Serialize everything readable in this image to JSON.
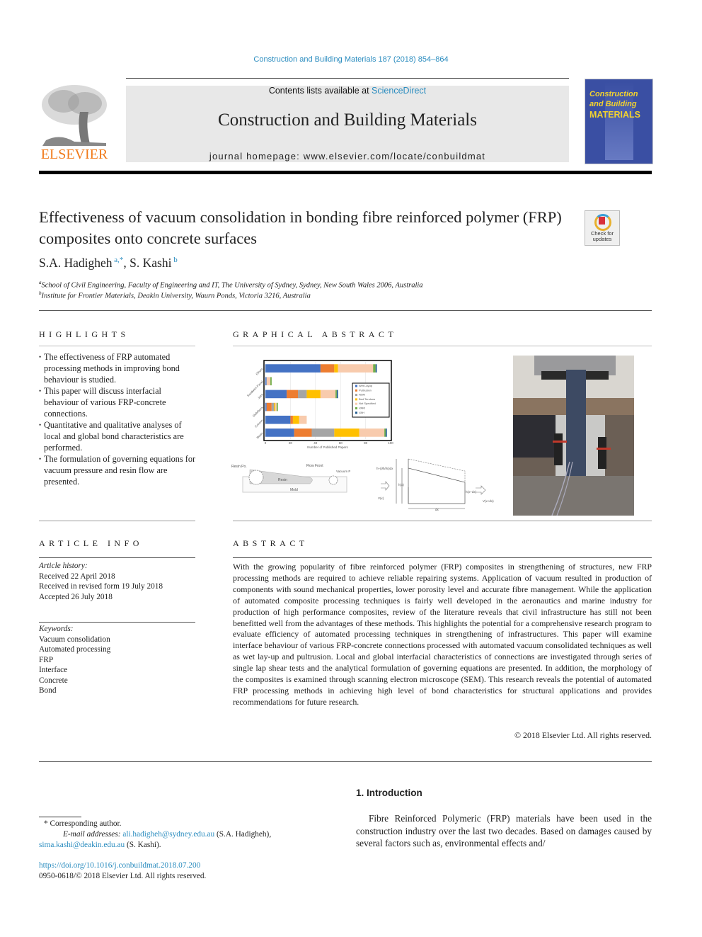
{
  "header": {
    "citation": "Construction and Building Materials 187 (2018) 854–864",
    "contents_prefix": "Contents lists available at ",
    "contents_link": "ScienceDirect",
    "journal_title": "Construction and Building Materials",
    "homepage": "journal homepage: www.elsevier.com/locate/conbuildmat",
    "publisher_logo": "ELSEVIER",
    "cover": {
      "line1": "Construction",
      "line2": "and Building",
      "line3": "MATERIALS"
    },
    "colors": {
      "link": "#2a8cbf",
      "elsevier_orange": "#f07a1a",
      "cover_blue": "#3a4fa3",
      "cover_yellow": "#f2d22f"
    }
  },
  "article": {
    "title": "Effectiveness of vacuum consolidation in bonding fibre reinforced polymer (FRP) composites onto concrete surfaces",
    "check_updates": {
      "line1": "Check for",
      "line2": "updates"
    },
    "authors": [
      {
        "name": "S.A. Hadigheh",
        "marks": "a,*"
      },
      {
        "name": "S. Kashi",
        "marks": "b"
      }
    ],
    "affiliations": [
      {
        "mark": "a",
        "text": "School of Civil Engineering, Faculty of Engineering and IT, The University of Sydney, Sydney, New South Wales 2006, Australia"
      },
      {
        "mark": "b",
        "text": "Institute for Frontier Materials, Deakin University, Waurn Ponds, Victoria 3216, Australia"
      }
    ]
  },
  "highlights": {
    "heading": "HIGHLIGHTS",
    "items": [
      "The effectiveness of FRP automated processing methods in improving bond behaviour is studied.",
      "This paper will discuss interfacial behaviour of various FRP-concrete connections.",
      "Quantitative and qualitative analyses of local and global bond characteristics are performed.",
      "The formulation of governing equations for vacuum pressure and resin flow are presented."
    ]
  },
  "graphical_abstract": {
    "heading": "GRAPHICAL ABSTRACT",
    "diagram1": {
      "resin_pot": "Resin Po.",
      "flow_front": "Flow Front",
      "vacuum_pump": "Vacuum Pump",
      "resin": "Resin",
      "mold": "Mold"
    },
    "diagram2": {
      "top_left": "h+(∂h/∂x)dx",
      "left_height": "h(x)",
      "inflow": "V(x)",
      "right": "h(x+dx)",
      "outflow": "V(x+dx)",
      "bottom": "dx"
    },
    "photo_alt": "Single lap shear test setup photograph"
  },
  "chart_data": {
    "type": "bar",
    "orientation": "horizontal-stacked",
    "title": "",
    "xlabel": "Number of Published Papers",
    "ylabel": "",
    "xlim": [
      0,
      100
    ],
    "xticks": [
      0,
      20,
      40,
      60,
      80,
      100
    ],
    "grid": true,
    "legend_position": "right",
    "categories": [
      "Others",
      "Sandwich Panel",
      "Joint",
      "Slab/Deck",
      "Column",
      "Beam"
    ],
    "series": [
      {
        "name": "Wet Layup",
        "color": "#4472c4",
        "values": [
          44,
          1,
          17,
          1,
          20,
          23
        ]
      },
      {
        "name": "Pultrusion",
        "color": "#ed7d31",
        "values": [
          11,
          0,
          9,
          4,
          2,
          14
        ]
      },
      {
        "name": "NSM",
        "color": "#a5a5a5",
        "values": [
          0,
          0,
          7,
          2,
          0,
          18
        ]
      },
      {
        "name": "Bed Tendons",
        "color": "#ffc000",
        "values": [
          3,
          0,
          11,
          1,
          5,
          20
        ]
      },
      {
        "name": "Not Specified",
        "color": "#f8cbad",
        "values": [
          28,
          3,
          12,
          1,
          6,
          20
        ]
      },
      {
        "name": "VARI",
        "color": "#70ad47",
        "values": [
          2,
          1,
          1,
          1,
          0,
          1
        ]
      },
      {
        "name": "VAH",
        "color": "#255e91",
        "values": [
          1,
          0,
          1,
          0,
          0,
          1
        ]
      }
    ]
  },
  "article_info": {
    "heading": "ARTICLE INFO",
    "history_label": "Article history:",
    "history": [
      "Received 22 April 2018",
      "Received in revised form 19 July 2018",
      "Accepted 26 July 2018"
    ],
    "keywords_label": "Keywords:",
    "keywords": [
      "Vacuum consolidation",
      "Automated processing",
      "FRP",
      "Interface",
      "Concrete",
      "Bond"
    ]
  },
  "abstract": {
    "heading": "ABSTRACT",
    "text": "With the growing popularity of fibre reinforced polymer (FRP) composites in strengthening of structures, new FRP processing methods are required to achieve reliable repairing systems. Application of vacuum resulted in production of components with sound mechanical properties, lower porosity level and accurate fibre management. While the application of automated composite processing techniques is fairly well developed in the aeronautics and marine industry for production of high performance composites, review of the literature reveals that civil infrastructure has still not been benefitted well from the advantages of these methods. This highlights the potential for a comprehensive research program to evaluate efficiency of automated processing techniques in strengthening of infrastructures. This paper will examine interface behaviour of various FRP-concrete connections processed with automated vacuum consolidated techniques as well as wet lay-up and pultrusion. Local and global interfacial characteristics of connections are investigated through series of single lap shear tests and the analytical formulation of governing equations are presented. In addition, the morphology of the composites is examined through scanning electron microscope (SEM). This research reveals the potential of automated FRP processing methods in achieving high level of bond characteristics for structural applications and provides recommendations for future research.",
    "copyright": "© 2018 Elsevier Ltd. All rights reserved."
  },
  "footnotes": {
    "corresponding": "* Corresponding author.",
    "email_label": "E-mail addresses:",
    "email1": "ali.hadigheh@sydney.edu.au",
    "email1_name": " (S.A. Hadigheh), ",
    "email2": "sima.kashi@deakin.edu.au",
    "email2_name": " (S. Kashi).",
    "doi": "https://doi.org/10.1016/j.conbuildmat.2018.07.200",
    "issn": "0950-0618/© 2018 Elsevier Ltd. All rights reserved."
  },
  "introduction": {
    "heading": "1. Introduction",
    "text": "Fibre Reinforced Polymeric (FRP) materials have been used in the construction industry over the last two decades. Based on damages caused by several factors such as, environmental effects and/"
  }
}
